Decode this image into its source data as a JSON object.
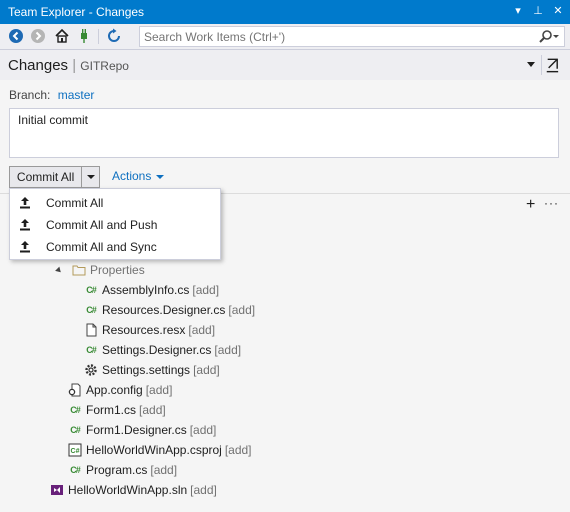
{
  "window": {
    "title": "Team Explorer - Changes"
  },
  "titlebar_buttons": {
    "dropdown": "▾",
    "pin": "⊥",
    "close": "✕"
  },
  "search": {
    "placeholder": "Search Work Items (Ctrl+')"
  },
  "header": {
    "title": "Changes",
    "separator": "|",
    "repo": "GITRepo"
  },
  "branch": {
    "label": "Branch:",
    "name": "master"
  },
  "commit_message": "Initial commit",
  "commit": {
    "button_label": "Commit All",
    "actions_label": "Actions"
  },
  "commit_menu": [
    {
      "label": "Commit All"
    },
    {
      "label": "Commit All and Push"
    },
    {
      "label": "Commit All and Sync"
    }
  ],
  "tree": [
    {
      "name": "Properties",
      "tag": "",
      "icon": "folder-icon",
      "level": 1
    },
    {
      "name": "AssemblyInfo.cs",
      "tag": "[add]",
      "icon": "csharp-file-icon",
      "level": 2
    },
    {
      "name": "Resources.Designer.cs",
      "tag": "[add]",
      "icon": "csharp-file-icon",
      "level": 2
    },
    {
      "name": "Resources.resx",
      "tag": "[add]",
      "icon": "resx-file-icon",
      "level": 2
    },
    {
      "name": "Settings.Designer.cs",
      "tag": "[add]",
      "icon": "csharp-file-icon",
      "level": 2
    },
    {
      "name": "Settings.settings",
      "tag": "[add]",
      "icon": "settings-gear-icon",
      "level": 2
    },
    {
      "name": "App.config",
      "tag": "[add]",
      "icon": "config-file-icon",
      "level": 1
    },
    {
      "name": "Form1.cs",
      "tag": "[add]",
      "icon": "csharp-file-icon",
      "level": 1
    },
    {
      "name": "Form1.Designer.cs",
      "tag": "[add]",
      "icon": "csharp-file-icon",
      "level": 1
    },
    {
      "name": "HelloWorldWinApp.csproj",
      "tag": "[add]",
      "icon": "csproj-file-icon",
      "level": 1
    },
    {
      "name": "Program.cs",
      "tag": "[add]",
      "icon": "csharp-file-icon",
      "level": 1
    },
    {
      "name": "HelloWorldWinApp.sln",
      "tag": "[add]",
      "icon": "solution-file-icon",
      "level": 0
    }
  ],
  "colors": {
    "titlebar": "#007acc",
    "link": "#0e70c0",
    "csharp": "#388a34"
  }
}
